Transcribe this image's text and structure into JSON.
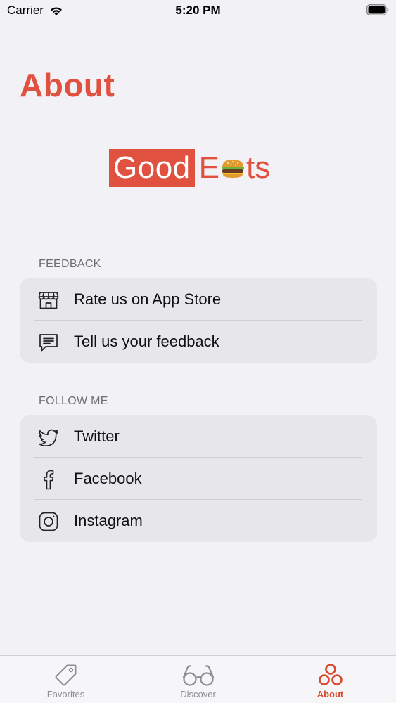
{
  "status_bar": {
    "carrier": "Carrier",
    "time": "5:20 PM"
  },
  "page": {
    "title": "About"
  },
  "logo": {
    "good": "Good",
    "e": "E",
    "ts": "ts"
  },
  "sections": {
    "feedback": {
      "header": "FEEDBACK",
      "items": [
        {
          "label": "Rate us on App Store",
          "icon": "store-icon"
        },
        {
          "label": "Tell us your feedback",
          "icon": "chat-bubble-icon"
        }
      ]
    },
    "follow": {
      "header": "FOLLOW ME",
      "items": [
        {
          "label": "Twitter",
          "icon": "twitter-icon"
        },
        {
          "label": "Facebook",
          "icon": "facebook-icon"
        },
        {
          "label": "Instagram",
          "icon": "instagram-icon"
        }
      ]
    }
  },
  "tab_bar": {
    "tabs": [
      {
        "label": "Favorites",
        "icon": "tag-icon",
        "active": false
      },
      {
        "label": "Discover",
        "icon": "glasses-icon",
        "active": false
      },
      {
        "label": "About",
        "icon": "circles-icon",
        "active": true
      }
    ]
  },
  "colors": {
    "accent": "#e0513f",
    "background": "#f2f1f6",
    "group_background": "#e7e6eb",
    "tab_active": "#d9482f",
    "tab_inactive": "#8e8e93"
  }
}
